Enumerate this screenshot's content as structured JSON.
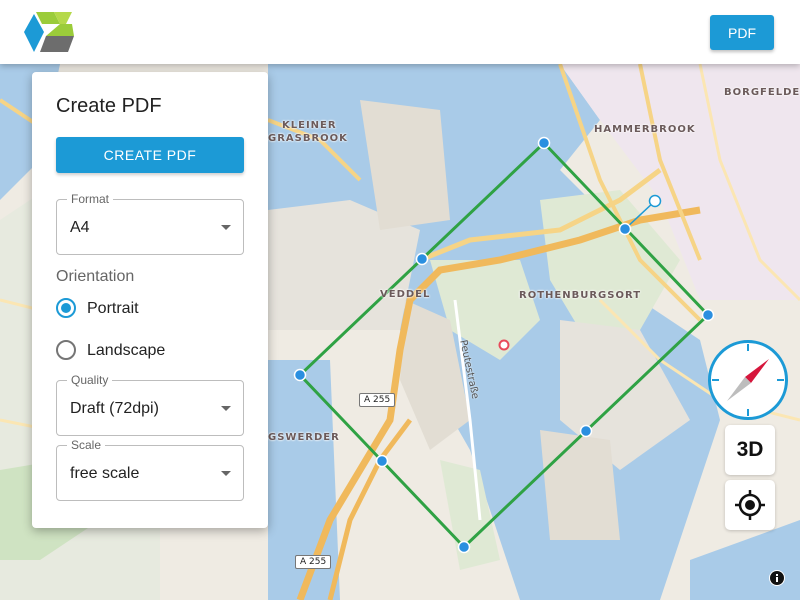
{
  "appbar": {
    "logo": "app-logo",
    "pdf_button": "PDF"
  },
  "panel": {
    "title": "Create PDF",
    "create_button": "CREATE PDF",
    "format": {
      "label": "Format",
      "value": "A4"
    },
    "orientation": {
      "label": "Orientation",
      "options": [
        {
          "label": "Portrait",
          "checked": true
        },
        {
          "label": "Landscape",
          "checked": false
        }
      ]
    },
    "quality": {
      "label": "Quality",
      "value": "Draft (72dpi)"
    },
    "scale": {
      "label": "Scale",
      "value": "free scale"
    }
  },
  "map": {
    "places": [
      "KLEINER",
      "GRASBROOK",
      "HAMMERBROOK",
      "BORGFELDE",
      "VEDDEL",
      "ROTHENBURGSORT",
      "GSWERDER"
    ],
    "street": "Peutestraße",
    "road_shields": [
      "A 255",
      "A 255"
    ],
    "accent_color": "#1c9ad6",
    "frame_color": "#2fa244"
  },
  "controls": {
    "compass": "compass-icon",
    "three_d": "3D",
    "locate": "locate-icon",
    "info": "info-icon"
  }
}
